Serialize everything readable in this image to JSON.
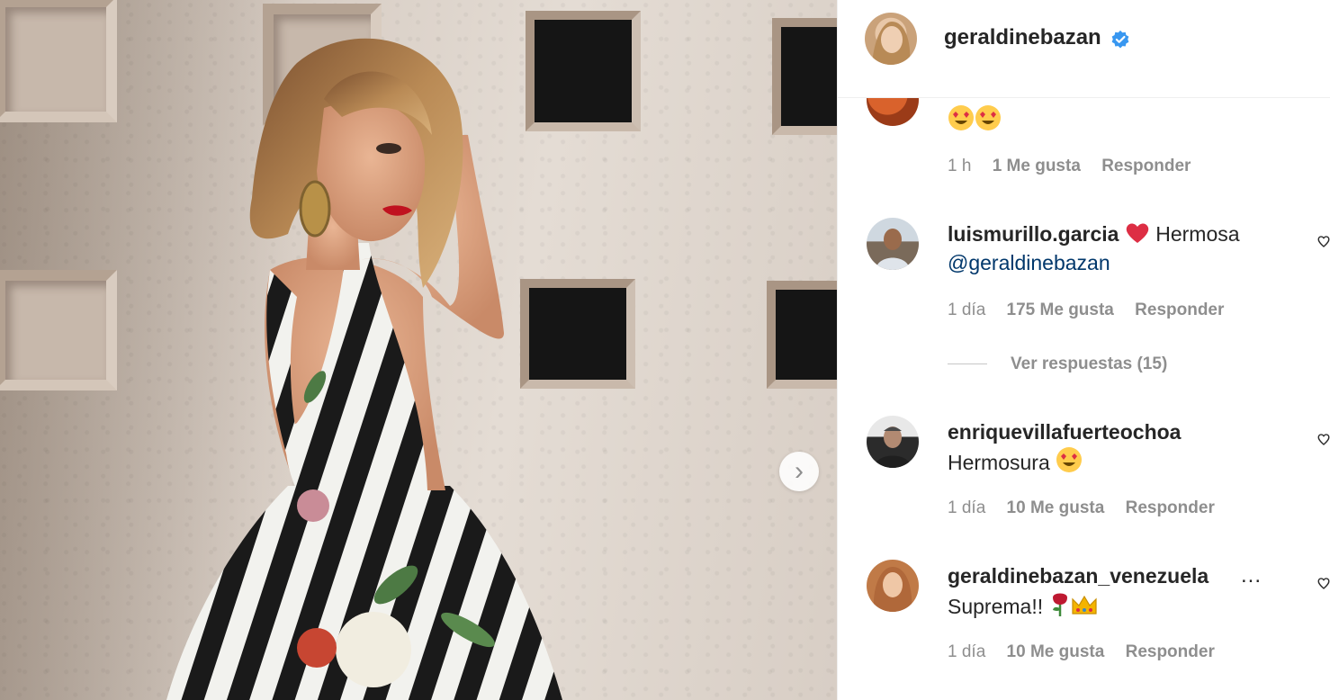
{
  "post": {
    "next_icon": "chevron-right-icon",
    "next_glyph": "›"
  },
  "header": {
    "username": "geraldinebazan",
    "verified_icon": "verified-badge-icon"
  },
  "comments": [
    {
      "text_emoji": "heart-eyes-emoji x2",
      "time": "1 h",
      "likes": "1 Me gusta",
      "reply": "Responder"
    },
    {
      "username": "luismurillo.garcia",
      "emoji": "red-heart-emoji",
      "text": "Hermosa",
      "mention": "@geraldinebazan",
      "time": "1 día",
      "likes": "175 Me gusta",
      "reply": "Responder",
      "view_replies": "Ver respuestas (15)"
    },
    {
      "username": "enriquevillafuerteochoa",
      "text": "Hermosura",
      "emoji": "heart-eyes-emoji",
      "time": "1 día",
      "likes": "10 Me gusta",
      "reply": "Responder"
    },
    {
      "username": "geraldinebazan_venezuela",
      "text": "Suprema!!",
      "emoji": "rose-emoji, crown-emoji",
      "time": "1 día",
      "likes": "10 Me gusta",
      "reply": "Responder",
      "more": "..."
    }
  ],
  "colors": {
    "link": "#00376b",
    "muted": "#8e8e8e",
    "verified": "#3897f0",
    "heart": "#ed1c2e"
  }
}
